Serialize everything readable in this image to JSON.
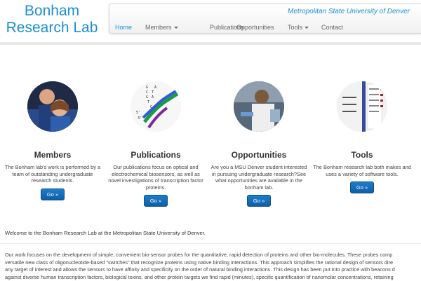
{
  "brand": {
    "line1": "Bonham",
    "line2": "Research Lab"
  },
  "header": {
    "university": "Metropolitan State University of Denver",
    "nav": [
      {
        "label": "Home",
        "active": true
      },
      {
        "label": "Members",
        "dropdown": true
      },
      {
        "label": "Publications"
      },
      {
        "label": "Opportunities"
      },
      {
        "label": "Tools",
        "dropdown": true
      },
      {
        "label": "Contact"
      }
    ]
  },
  "features": [
    {
      "title": "Members",
      "text": "The Bonham lab's work is performed by a team of outstanding undergraduate research students.",
      "button": "Go »",
      "image": "team-photo"
    },
    {
      "title": "Publications",
      "text": "Our publications focus on optical and electrochemical biosensors, as well as novel investigations of transcription factor proteins.",
      "button": "Go »",
      "image": "dna-structure"
    },
    {
      "title": "Opportunities",
      "text": "Are you a MSU Denver student interested in pursuing undergraduate research?See what opportunities are available in the bonham lab.",
      "button": "Go »",
      "image": "lab-photo"
    },
    {
      "title": "Tools",
      "text": "The Bonham research lab both makes and uses a variety of software tools.",
      "button": "Go »",
      "image": "software-screenshot"
    }
  ],
  "welcome": "Welcome to the Bonham Research Lab at the Metropolitan State University of Denver.",
  "body_lines": [
    "Our work focuses on the development of simple, convenient bio-sensor probes for the quantitative, rapid detection of proteins and other bio-molecules. These probes comp",
    "versatile new class of oligonucleotide-based \"switches\" that recognize proteins using native binding interactions. This approach simplifies the rational design of sensors dire",
    "any target of interest and allows the sensors to have affinity and specificity on the order of natural binding interactions. This design has been put into practice with beacons d",
    "against diverse human transcription factors, biological toxins, and other protein targets we find rapid (minutes), specific quantification of nanomolar concentrations, retaining"
  ],
  "colors": {
    "accent": "#1a8fd1",
    "button": "#1469b3"
  }
}
